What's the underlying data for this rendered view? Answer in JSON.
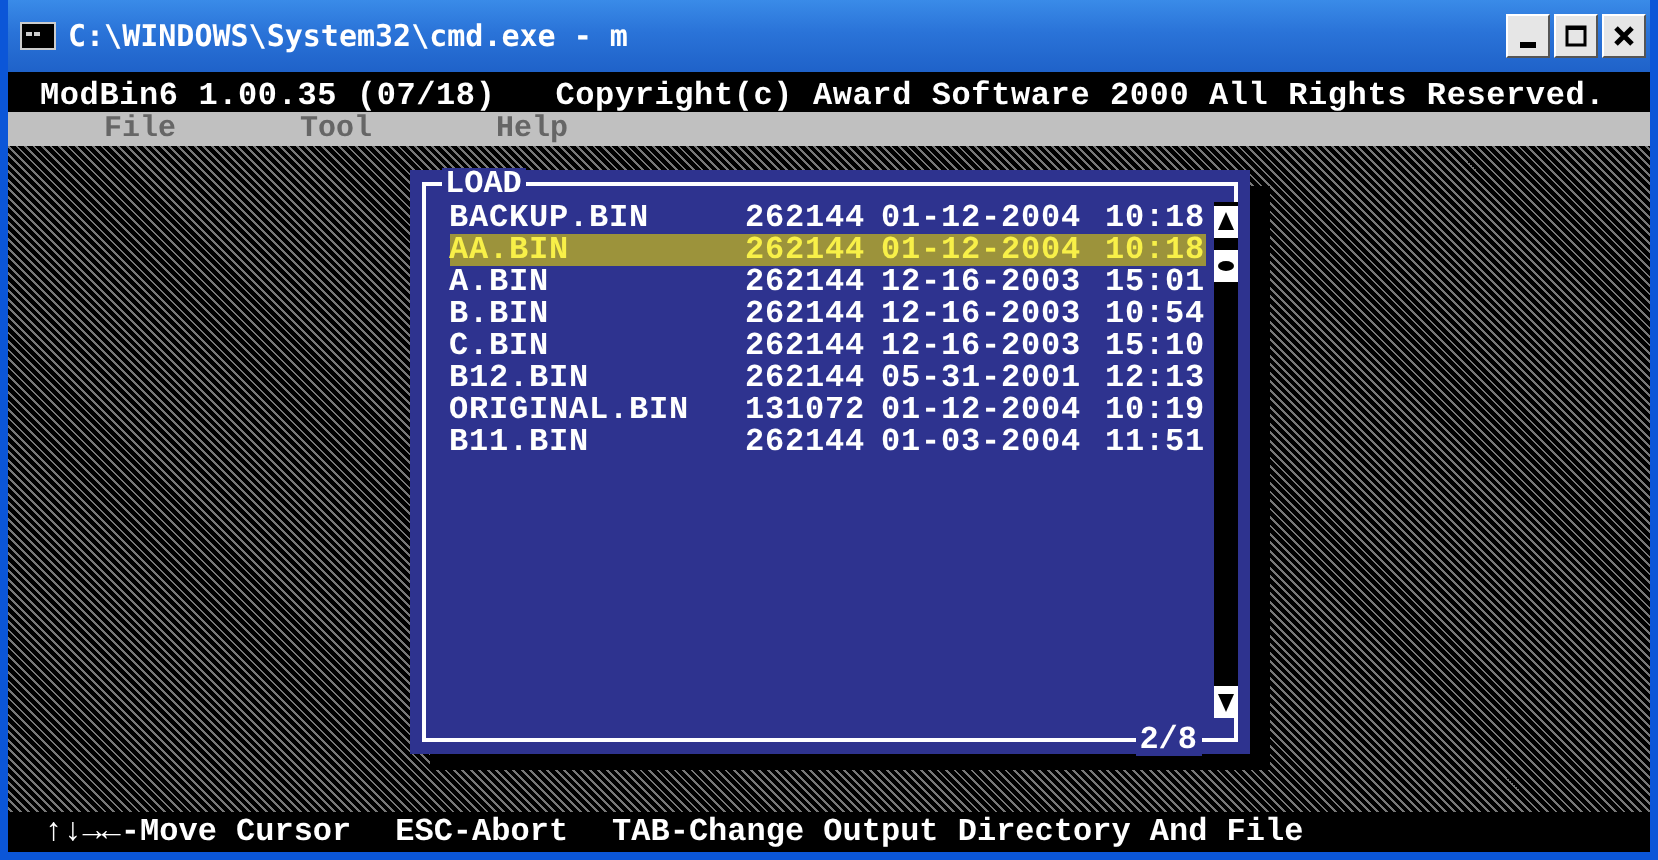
{
  "window": {
    "title": "C:\\WINDOWS\\System32\\cmd.exe - m"
  },
  "header": {
    "program": "ModBin6 1.00.35 (07/18)",
    "copyright": "Copyright(c) Award Software 2000 All Rights Reserved."
  },
  "menu": [
    {
      "label": "File"
    },
    {
      "label": "Tool"
    },
    {
      "label": "Help"
    }
  ],
  "dialog": {
    "title": "LOAD",
    "page": "2/8",
    "files": [
      {
        "name": "BACKUP.BIN",
        "size": "262144",
        "date": "01-12-2004",
        "time": "10:18",
        "selected": false
      },
      {
        "name": "AA.BIN",
        "size": "262144",
        "date": "01-12-2004",
        "time": "10:18",
        "selected": true
      },
      {
        "name": "A.BIN",
        "size": "262144",
        "date": "12-16-2003",
        "time": "15:01",
        "selected": false
      },
      {
        "name": "B.BIN",
        "size": "262144",
        "date": "12-16-2003",
        "time": "10:54",
        "selected": false
      },
      {
        "name": "C.BIN",
        "size": "262144",
        "date": "12-16-2003",
        "time": "15:10",
        "selected": false
      },
      {
        "name": "B12.BIN",
        "size": "262144",
        "date": "05-31-2001",
        "time": "12:13",
        "selected": false
      },
      {
        "name": "ORIGINAL.BIN",
        "size": "131072",
        "date": "01-12-2004",
        "time": "10:19",
        "selected": false
      },
      {
        "name": "B11.BIN",
        "size": "262144",
        "date": "01-03-2004",
        "time": "11:51",
        "selected": false
      }
    ]
  },
  "status_bar": [
    "↑↓→←-Move Cursor",
    "ESC-Abort",
    "TAB-Change Output Directory And File"
  ]
}
